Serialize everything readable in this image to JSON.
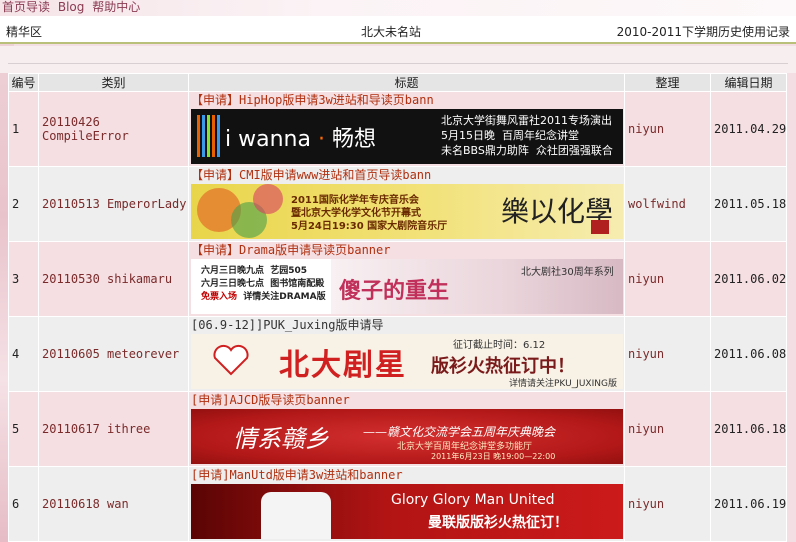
{
  "topnav": {
    "links": [
      "首页导读",
      "Blog",
      "帮助中心"
    ]
  },
  "header": {
    "left": "精华区",
    "center": "北大未名站",
    "right": "2010-2011下学期历史使用记录"
  },
  "table": {
    "headers": [
      "编号",
      "类别",
      "标题",
      "整理",
      "编辑日期"
    ],
    "rows": [
      {
        "num": "1",
        "id": "20110426",
        "category": "CompileError",
        "title": "【申请】HipHop版申请3w进站和导读页bann",
        "editor": "niyun",
        "date": "2011.04.29",
        "banner": {
          "main": "i wanna",
          "sep": "·",
          "main2": "畅想",
          "lines": "北京大学街舞风雷社2011专场演出\n5月15日晚  百周年纪念讲堂\n未名BBS鼎力助阵  众社团强强联合"
        }
      },
      {
        "num": "2",
        "id": "20110513",
        "category": "EmperorLady",
        "title": "【申请】CMI版申请www进站和首页导读bann",
        "editor": "wolfwind",
        "date": "2011.05.18",
        "banner": {
          "lines": "2011国际化学年专庆音乐会\n暨北京大学化学文化节开幕式\n5月24日19:30 国家大剧院音乐厅",
          "cal": "樂以化學"
        }
      },
      {
        "num": "3",
        "id": "20110530",
        "category": "shikamaru",
        "title": "【申请】Drama版申请导读页banner",
        "editor": "niyun",
        "date": "2011.06.02",
        "banner": {
          "lines": "六月三日晚九点  艺园505\n六月三日晚七点  图书馆南配殿",
          "free": "免票入场",
          "follow": "详情关注DRAMA版",
          "main": "傻子的重生",
          "note": "北大剧社30周年系列"
        }
      },
      {
        "num": "4",
        "id": "20110605",
        "category": "meteorever",
        "title": "[06.9-12]]PUK_Juxing版申请导",
        "editor": "niyun",
        "date": "2011.06.08",
        "banner": {
          "deadline": "征订截止时间：6.12",
          "main": "北大剧星",
          "sub": "版衫火热征订中！",
          "note": "详情请关注PKU_JUXING版"
        }
      },
      {
        "num": "5",
        "id": "20110617",
        "category": "ithree",
        "title": "[申请]AJCD版导读页banner",
        "editor": "niyun",
        "date": "2011.06.18",
        "banner": {
          "main": "情系赣乡",
          "line1": "——赣文化交流学会五周年庆典晚会",
          "line2": "北京大学百周年纪念讲堂多功能厅",
          "line3": "2011年6月23日 晚19:00—22:00"
        }
      },
      {
        "num": "6",
        "id": "20110618",
        "category": "wan",
        "title": "[申请]ManUtd版申请3w进站和banner",
        "editor": "niyun",
        "date": "2011.06.19",
        "banner": {
          "main": "Glory Glory Man United",
          "sub": "曼联版版衫火热征订！"
        }
      }
    ]
  }
}
